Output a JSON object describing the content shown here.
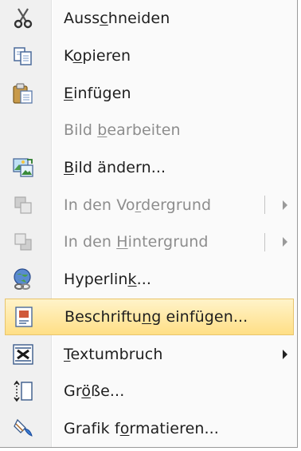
{
  "menu": {
    "items": [
      {
        "pre": "Auss",
        "u": "c",
        "post": "hneiden",
        "icon": "scissors-icon",
        "disabled": false
      },
      {
        "pre": "K",
        "u": "o",
        "post": "pieren",
        "icon": "copy-icon",
        "disabled": false
      },
      {
        "pre": "",
        "u": "E",
        "post": "infügen",
        "icon": "paste-icon",
        "disabled": false
      },
      {
        "pre": "Bild ",
        "u": "b",
        "post": "earbeiten",
        "icon": "",
        "disabled": true
      },
      {
        "pre": "",
        "u": "B",
        "post": "ild ändern...",
        "icon": "change-picture-icon",
        "disabled": false
      },
      {
        "pre": "In den Vo",
        "u": "r",
        "post": "dergrund",
        "icon": "bring-to-front-icon",
        "disabled": true,
        "submenu": true
      },
      {
        "pre": "In den ",
        "u": "H",
        "post": "intergrund",
        "icon": "send-to-back-icon",
        "disabled": true,
        "submenu": true
      },
      {
        "pre": "Hyperlin",
        "u": "k",
        "post": "...",
        "icon": "hyperlink-icon",
        "disabled": false
      },
      {
        "pre": "Beschriftu",
        "u": "n",
        "post": "g einfügen...",
        "icon": "insert-caption-icon",
        "disabled": false,
        "highlighted": true
      },
      {
        "pre": "",
        "u": "T",
        "post": "extumbruch",
        "icon": "text-wrap-icon",
        "disabled": false,
        "submenu": true
      },
      {
        "pre": "Gr",
        "u": "ö",
        "post": "ße...",
        "icon": "size-icon",
        "disabled": false
      },
      {
        "pre": "Grafik f",
        "u": "o",
        "post": "rmatieren...",
        "icon": "format-picture-icon",
        "disabled": false
      }
    ]
  }
}
